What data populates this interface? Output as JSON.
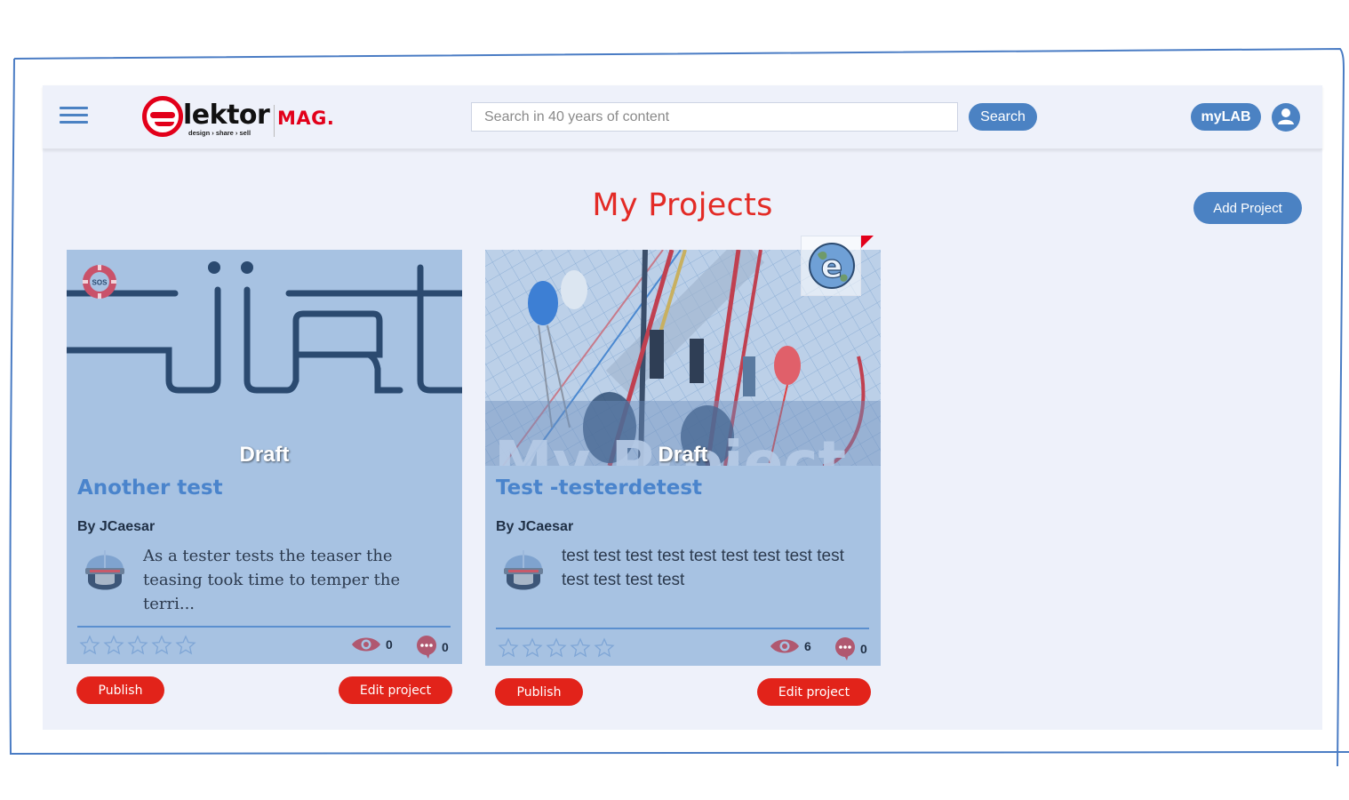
{
  "header": {
    "logo_text": "lektor",
    "logo_tagline": "design › share › sell",
    "logo_mag": "MAG.",
    "search_placeholder": "Search in 40 years of content",
    "search_value": "",
    "search_label": "Search",
    "mylab_label": "myLAB"
  },
  "page": {
    "title": "My Projects",
    "add_project_label": "Add Project"
  },
  "colors": {
    "accent_blue": "#4b82c3",
    "title_red": "#e32b26",
    "button_red": "#e2231a",
    "card_bg": "#a7c2e2",
    "page_bg": "#eef1fa"
  },
  "projects": [
    {
      "status": "Draft",
      "title": "Another test",
      "author": "By JCaesar",
      "teaser": "As a tester tests the teaser the teasing took time to temper the terri...",
      "rating": 0,
      "views": "0",
      "comments": "0",
      "badge": "sos-icon",
      "publish_label": "Publish",
      "edit_label": "Edit project"
    },
    {
      "status": "Draft",
      "title": "Test -testerdetest",
      "author": "By JCaesar",
      "teaser": "test test test test test test test test test test test test test",
      "image_text": "My Project",
      "rating": 0,
      "views": "6",
      "comments": "0",
      "badge": "elektor-globe-icon",
      "publish_label": "Publish",
      "edit_label": "Edit project"
    }
  ]
}
